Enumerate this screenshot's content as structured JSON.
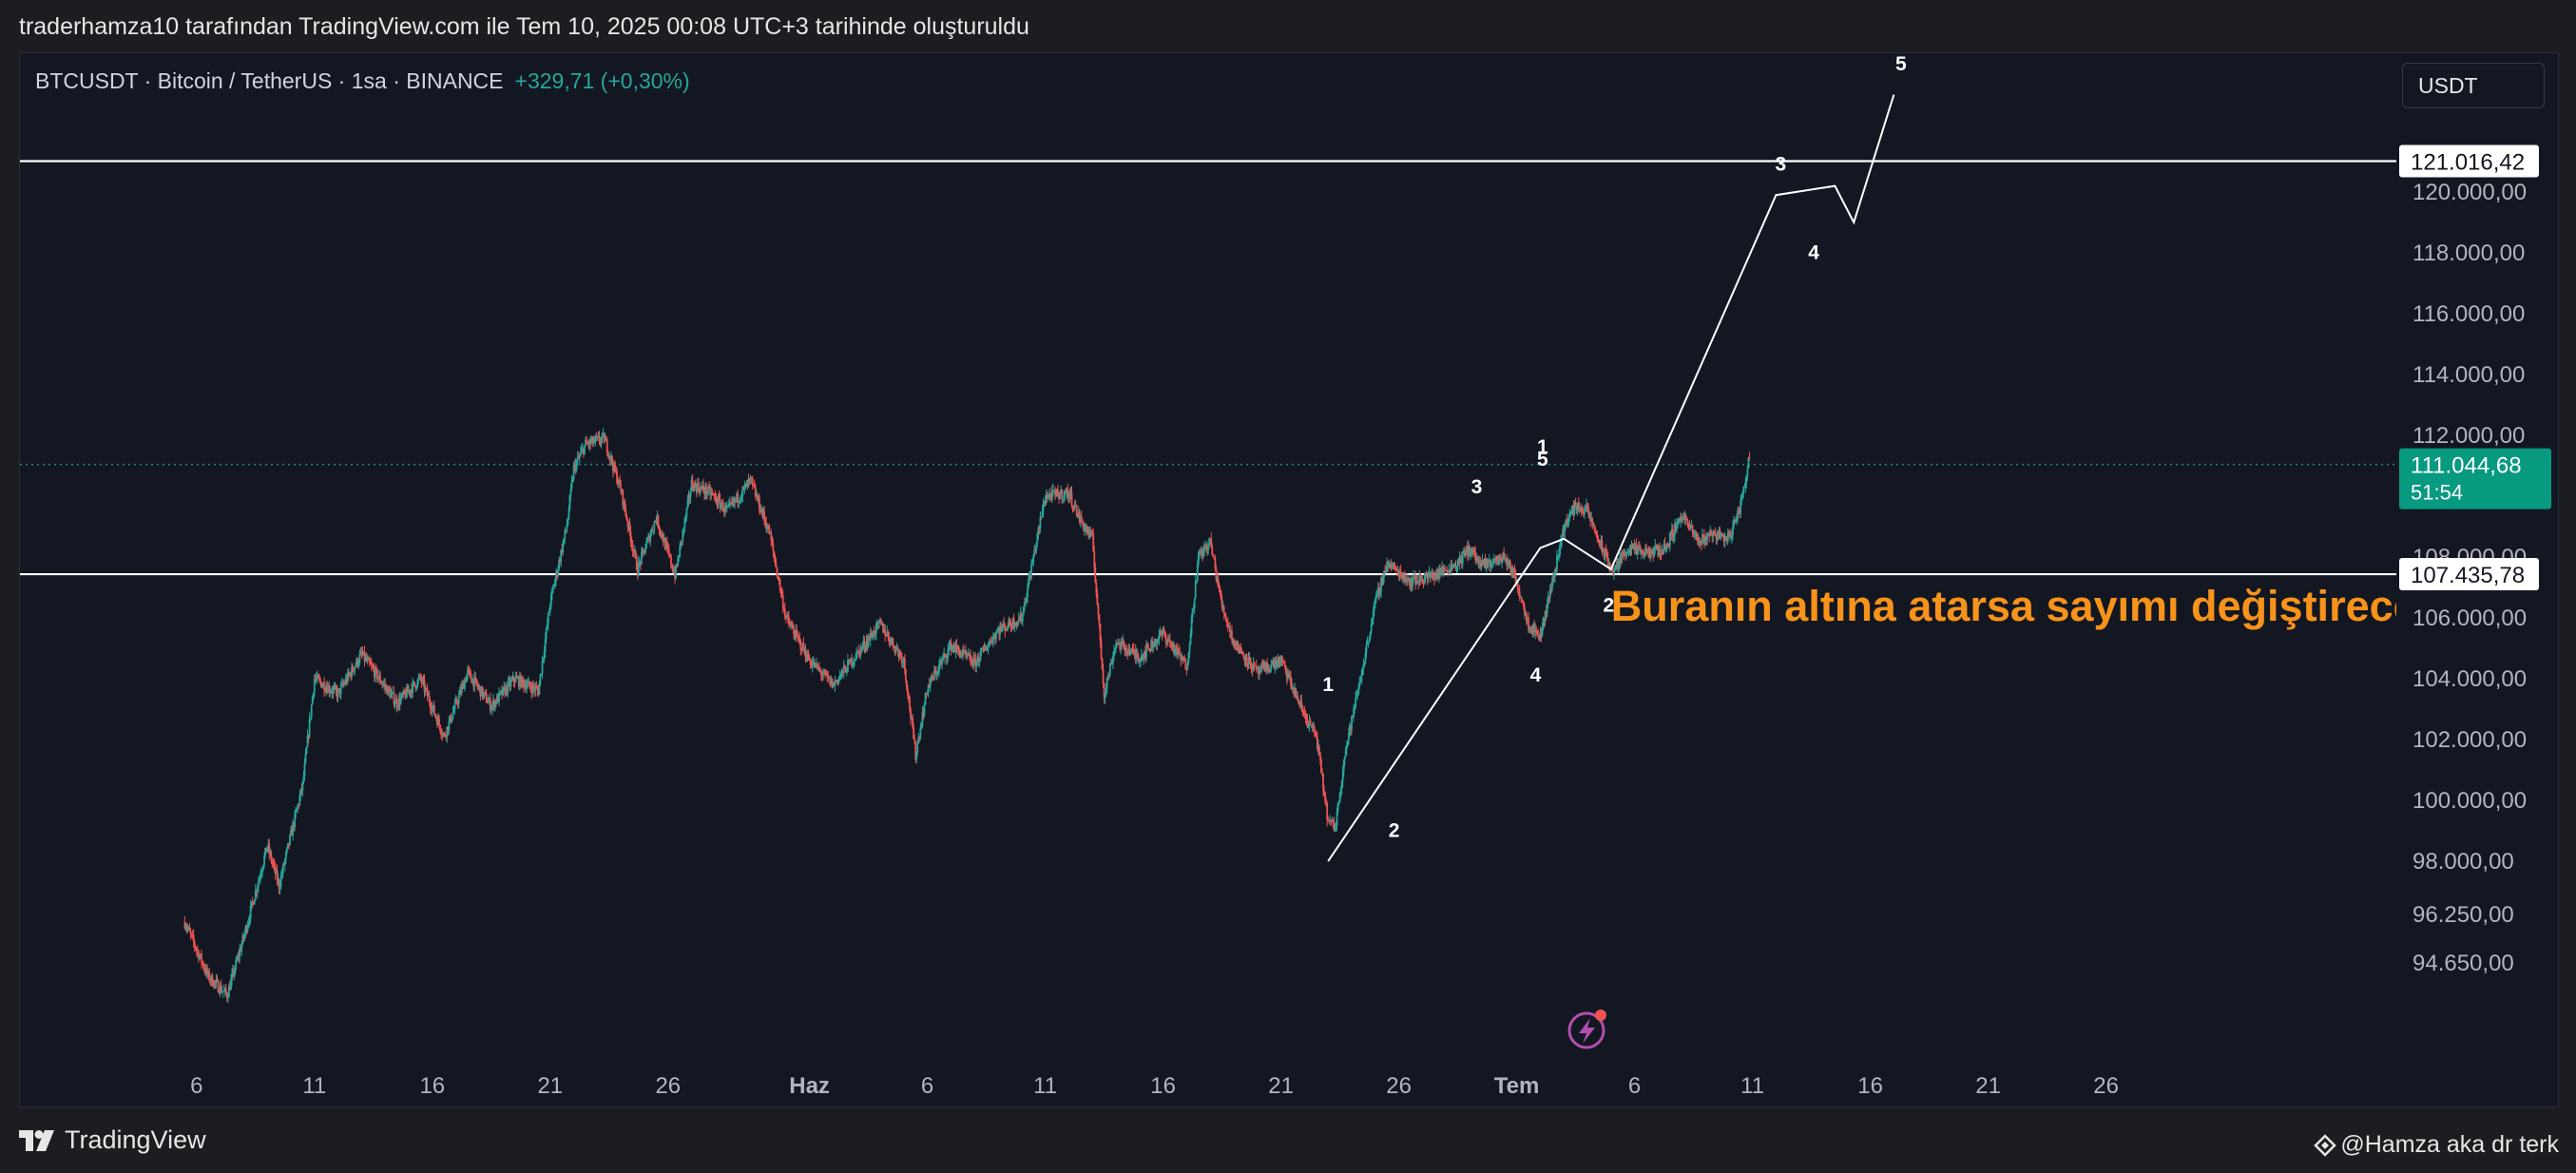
{
  "caption": "traderhamza10 tarafından TradingView.com ile Tem 10, 2025 00:08 UTC+3 tarihinde oluşturuldu",
  "header": {
    "symbol": "BTCUSDT · Bitcoin / TetherUS · 1sa · BINANCE",
    "change": "+329,71 (+0,30%)"
  },
  "currency_button": "USDT",
  "footer": {
    "logo_text": "TradingView",
    "author": "@Hamza aka dr terk"
  },
  "colors": {
    "background": "#131722",
    "up": "#26a69a",
    "down": "#ef5350",
    "annotation": "#f7931a",
    "drawing": "#ffffff"
  },
  "chart_data": {
    "type": "candlestick",
    "symbol": "BTCUSDT",
    "interval": "1sa",
    "ylim": [
      93000,
      124500
    ],
    "x_ticks": [
      {
        "label": "6",
        "day": 6
      },
      {
        "label": "11",
        "day": 11
      },
      {
        "label": "16",
        "day": 16
      },
      {
        "label": "21",
        "day": 21
      },
      {
        "label": "26",
        "day": 26
      },
      {
        "label": "Haz",
        "day": 32
      },
      {
        "label": "6",
        "day": 37
      },
      {
        "label": "11",
        "day": 42
      },
      {
        "label": "16",
        "day": 47
      },
      {
        "label": "21",
        "day": 52
      },
      {
        "label": "26",
        "day": 57
      },
      {
        "label": "Tem",
        "day": 62
      },
      {
        "label": "6",
        "day": 67
      },
      {
        "label": "11",
        "day": 72
      },
      {
        "label": "16",
        "day": 77
      },
      {
        "label": "21",
        "day": 82
      },
      {
        "label": "26",
        "day": 87
      }
    ],
    "y_ticks": [
      {
        "label": "120.000,00",
        "value": 120000
      },
      {
        "label": "118.000,00",
        "value": 118000
      },
      {
        "label": "116.000,00",
        "value": 116000
      },
      {
        "label": "114.000,00",
        "value": 114000
      },
      {
        "label": "112.000,00",
        "value": 112000
      },
      {
        "label": "108.000,00",
        "value": 108000
      },
      {
        "label": "106.000,00",
        "value": 106000
      },
      {
        "label": "104.000,00",
        "value": 104000
      },
      {
        "label": "102.000,00",
        "value": 102000
      },
      {
        "label": "100.000,00",
        "value": 100000
      },
      {
        "label": "98.000,00",
        "value": 98000
      },
      {
        "label": "96.250,00",
        "value": 96250
      },
      {
        "label": "94.650,00",
        "value": 94650
      }
    ],
    "price_path": [
      [
        5.5,
        96000
      ],
      [
        6.5,
        94200
      ],
      [
        7.3,
        93600
      ],
      [
        8.0,
        95500
      ],
      [
        9.0,
        98500
      ],
      [
        9.5,
        97200
      ],
      [
        10.5,
        100500
      ],
      [
        11.0,
        104000
      ],
      [
        12.0,
        103500
      ],
      [
        13.0,
        104800
      ],
      [
        14.5,
        103200
      ],
      [
        15.5,
        104000
      ],
      [
        16.5,
        102100
      ],
      [
        17.5,
        104200
      ],
      [
        18.5,
        103100
      ],
      [
        19.5,
        104000
      ],
      [
        20.5,
        103600
      ],
      [
        21.0,
        106500
      ],
      [
        21.7,
        109000
      ],
      [
        22.0,
        110900
      ],
      [
        22.5,
        111700
      ],
      [
        23.3,
        111900
      ],
      [
        24.0,
        110200
      ],
      [
        24.7,
        107600
      ],
      [
        25.5,
        109300
      ],
      [
        26.3,
        107400
      ],
      [
        27.0,
        110400
      ],
      [
        27.8,
        110100
      ],
      [
        28.5,
        109500
      ],
      [
        29.5,
        110500
      ],
      [
        30.3,
        108800
      ],
      [
        31.0,
        106000
      ],
      [
        32.0,
        104600
      ],
      [
        33.0,
        103800
      ],
      [
        34.0,
        104800
      ],
      [
        35.0,
        105800
      ],
      [
        36.0,
        104600
      ],
      [
        36.5,
        101500
      ],
      [
        37.0,
        103700
      ],
      [
        38.0,
        105100
      ],
      [
        39.0,
        104500
      ],
      [
        40.0,
        105600
      ],
      [
        41.0,
        106000
      ],
      [
        42.0,
        110000
      ],
      [
        43.0,
        110100
      ],
      [
        43.5,
        109200
      ],
      [
        44.0,
        108600
      ],
      [
        44.5,
        103500
      ],
      [
        45.0,
        105200
      ],
      [
        46.0,
        104700
      ],
      [
        47.0,
        105500
      ],
      [
        48.0,
        104400
      ],
      [
        48.5,
        108000
      ],
      [
        49.0,
        108500
      ],
      [
        49.5,
        106400
      ],
      [
        50.0,
        105200
      ],
      [
        51.0,
        104200
      ],
      [
        52.0,
        104600
      ],
      [
        53.0,
        102800
      ],
      [
        53.5,
        102100
      ],
      [
        54.0,
        99300
      ],
      [
        54.3,
        99100
      ],
      [
        54.7,
        101500
      ],
      [
        55.5,
        104500
      ],
      [
        56.0,
        106500
      ],
      [
        56.5,
        107800
      ],
      [
        57.5,
        107200
      ],
      [
        58.5,
        107400
      ],
      [
        59.5,
        107800
      ],
      [
        60.0,
        108300
      ],
      [
        60.5,
        107700
      ],
      [
        61.5,
        108000
      ],
      [
        62.0,
        107200
      ],
      [
        62.5,
        105800
      ],
      [
        63.0,
        105400
      ],
      [
        63.6,
        107500
      ],
      [
        64.0,
        109000
      ],
      [
        64.5,
        109700
      ],
      [
        65.0,
        109500
      ],
      [
        65.6,
        108300
      ],
      [
        66.1,
        107500
      ],
      [
        66.7,
        108300
      ],
      [
        67.5,
        108100
      ],
      [
        68.3,
        108300
      ],
      [
        69.0,
        109400
      ],
      [
        69.7,
        108500
      ],
      [
        70.3,
        108800
      ],
      [
        71.0,
        108600
      ],
      [
        71.5,
        109700
      ],
      [
        71.9,
        111400
      ]
    ],
    "price_lines": [
      {
        "value": 121016.42,
        "label": "121.016,42"
      },
      {
        "value": 107435.78,
        "label": "107.435,78"
      }
    ],
    "current_price": {
      "value": 111044.68,
      "label": "111.044,68",
      "countdown": "51:54"
    },
    "elliott_wave_lines": [
      [
        [
          54.0,
          98000
        ],
        [
          63.0,
          108300
        ],
        [
          64.0,
          108600
        ],
        [
          66.0,
          107600
        ],
        [
          73.0,
          119900
        ],
        [
          75.5,
          120200
        ],
        [
          76.3,
          119000
        ],
        [
          78.0,
          123200
        ]
      ]
    ],
    "wave_labels": [
      {
        "text": "1",
        "x": 54.0,
        "y": 103600
      },
      {
        "text": "2",
        "x": 56.8,
        "y": 98800
      },
      {
        "text": "3",
        "x": 60.3,
        "y": 110100
      },
      {
        "text": "4",
        "x": 62.8,
        "y": 103900
      },
      {
        "text": "5",
        "x": 63.1,
        "y": 111000
      },
      {
        "text": "1",
        "x": 63.1,
        "y": 111400
      },
      {
        "text": "2",
        "x": 65.9,
        "y": 106200
      },
      {
        "text": "3",
        "x": 73.2,
        "y": 120700
      },
      {
        "text": "4",
        "x": 74.6,
        "y": 117800
      },
      {
        "text": "5",
        "x": 78.3,
        "y": 124000
      }
    ],
    "annotation": {
      "text": "Buranın altına atarsa sayımı değiştireceğim",
      "x": 66.0,
      "y": 105900
    }
  }
}
